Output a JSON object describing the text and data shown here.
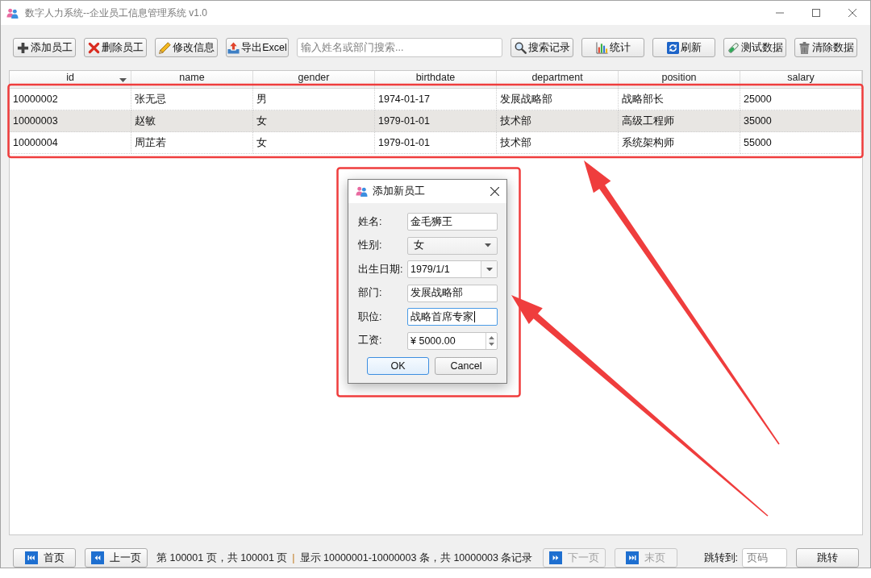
{
  "window": {
    "title": "数字人力系统--企业员工信息管理系统 v1.0"
  },
  "toolbar": {
    "left_buttons": [
      "添加员工",
      "删除员工",
      "修改信息",
      "导出Excel"
    ],
    "search": {
      "placeholder": "输入姓名或部门搜索..."
    },
    "right_buttons": [
      "搜索记录",
      "统计",
      "刷新",
      "测试数据",
      "清除数据"
    ]
  },
  "table": {
    "columns": [
      {
        "label": "id",
        "sorted": true
      },
      {
        "label": "name",
        "sorted": false
      },
      {
        "label": "gender",
        "sorted": false
      },
      {
        "label": "birthdate",
        "sorted": false
      },
      {
        "label": "department",
        "sorted": false
      },
      {
        "label": "position",
        "sorted": false
      },
      {
        "label": "salary",
        "sorted": false
      }
    ],
    "rows": [
      [
        "10000002",
        "张无忌",
        "男",
        "1974-01-17",
        "发展战略部",
        "战略部长",
        "25000"
      ],
      [
        "10000003",
        "赵敏",
        "女",
        "1979-01-01",
        "技术部",
        "高级工程师",
        "35000"
      ],
      [
        "10000004",
        "周芷若",
        "女",
        "1979-01-01",
        "技术部",
        "系统架构师",
        "55000"
      ]
    ]
  },
  "dialog": {
    "title": "添加新员工",
    "fields": [
      {
        "label": "姓名:",
        "kind": "text",
        "value": "金毛狮王",
        "focused": false
      },
      {
        "label": "性别:",
        "kind": "combo",
        "value": "女",
        "focused": false
      },
      {
        "label": "出生日期:",
        "kind": "date",
        "value": "1979/1/1",
        "focused": false
      },
      {
        "label": "部门:",
        "kind": "text",
        "value": "发展战略部",
        "focused": false
      },
      {
        "label": "职位:",
        "kind": "text",
        "value": "战略首席专家",
        "focused": true
      },
      {
        "label": "工资:",
        "kind": "spin",
        "value": "¥ 5000.00",
        "focused": false
      }
    ],
    "buttons": [
      {
        "label": "OK",
        "default": true
      },
      {
        "label": "Cancel",
        "default": false
      }
    ]
  },
  "pager": {
    "back_buttons": [
      {
        "label": "首页",
        "disabled": false
      },
      {
        "label": "上一页",
        "disabled": false
      }
    ],
    "page_info": "第 100001 页，共 100001 页",
    "separator": "|",
    "range_info": "显示 10000001-10000003 条，共 10000003 条记录",
    "forward_buttons": [
      {
        "label": "下一页",
        "disabled": true
      },
      {
        "label": "末页",
        "disabled": true
      }
    ],
    "jump_label": "跳转到:",
    "jump_field": {
      "placeholder": "页码"
    },
    "jump_button": "跳转"
  }
}
